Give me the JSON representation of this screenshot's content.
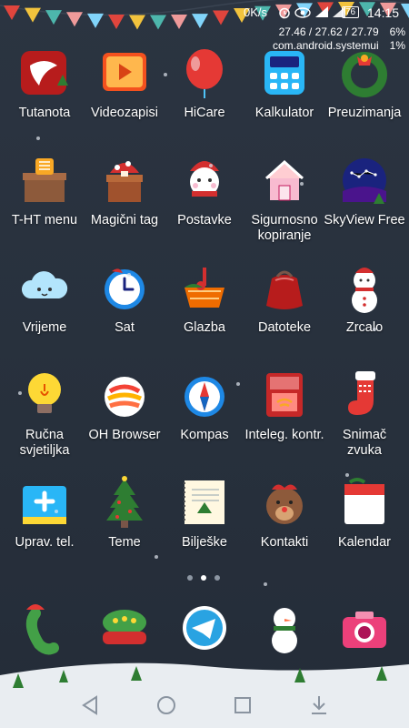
{
  "status_bar": {
    "network_speed": "0K/s",
    "battery": "76",
    "time": "14:15"
  },
  "debug_overlay": {
    "load": "27.46 / 27.62 / 27.79",
    "load_pct": "6%",
    "process": "com.android.systemui",
    "process_pct": "1%"
  },
  "apps": [
    {
      "label": "Tutanota",
      "icon": "tutanota-icon"
    },
    {
      "label": "Videozapisi",
      "icon": "video-icon"
    },
    {
      "label": "HiCare",
      "icon": "balloon-icon"
    },
    {
      "label": "Kalkulator",
      "icon": "calculator-icon"
    },
    {
      "label": "Preuzimanja",
      "icon": "wreath-icon"
    },
    {
      "label": "T-HT menu",
      "icon": "sim-chimney-icon"
    },
    {
      "label": "Magični tag",
      "icon": "mushroom-chimney-icon"
    },
    {
      "label": "Postavke",
      "icon": "snowman-settings-icon"
    },
    {
      "label": "Sigurnosno kopiranje",
      "icon": "house-backup-icon"
    },
    {
      "label": "SkyView Free",
      "icon": "night-sky-icon"
    },
    {
      "label": "Vrijeme",
      "icon": "cloud-weather-icon"
    },
    {
      "label": "Sat",
      "icon": "clock-icon"
    },
    {
      "label": "Glazba",
      "icon": "music-basket-icon"
    },
    {
      "label": "Datoteke",
      "icon": "gift-sack-icon"
    },
    {
      "label": "Zrcalo",
      "icon": "snowman-mirror-icon"
    },
    {
      "label": "Ručna svjetiljka",
      "icon": "lightbulb-icon"
    },
    {
      "label": "OH Browser",
      "icon": "browser-ball-icon"
    },
    {
      "label": "Kompas",
      "icon": "compass-icon"
    },
    {
      "label": "Inteleg. kontr.",
      "icon": "remote-control-icon"
    },
    {
      "label": "Snimač zvuka",
      "icon": "stocking-icon"
    },
    {
      "label": "Uprav. tel.",
      "icon": "phone-manager-icon"
    },
    {
      "label": "Teme",
      "icon": "christmas-tree-icon"
    },
    {
      "label": "Bilješke",
      "icon": "notebook-icon"
    },
    {
      "label": "Kontakti",
      "icon": "reindeer-icon"
    },
    {
      "label": "Kalendar",
      "icon": "calendar-icon"
    }
  ],
  "dock": [
    {
      "icon": "phone-icon"
    },
    {
      "icon": "messages-icon"
    },
    {
      "icon": "telegram-icon"
    },
    {
      "icon": "snowman-icon"
    },
    {
      "icon": "camera-icon"
    }
  ],
  "page_indicator": {
    "pages": 3,
    "active": 2
  },
  "colors": {
    "background": "#29323e",
    "bunting_red": "#e0453d",
    "bunting_yellow": "#f2c33d",
    "bunting_teal": "#4db6ac"
  }
}
